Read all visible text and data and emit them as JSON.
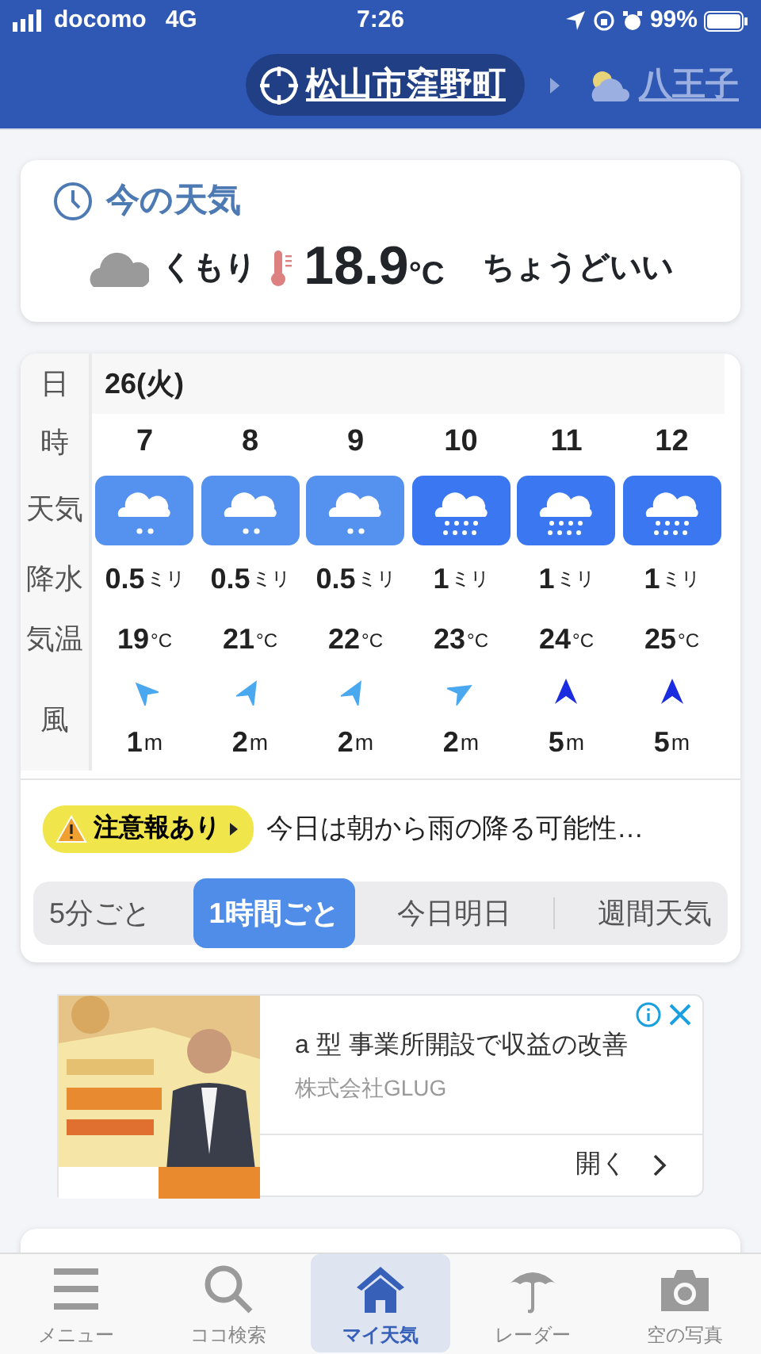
{
  "status_bar": {
    "carrier": "docomo",
    "network": "4G",
    "time": "7:26",
    "battery": "99%"
  },
  "locations": [
    {
      "name": "松山市窪野町",
      "selected": true
    },
    {
      "name": "八王子",
      "selected": false
    }
  ],
  "current": {
    "title": "今の天気",
    "condition": "くもり",
    "temperature": "18.9",
    "temperature_unit": "°C",
    "feeling": "ちょうどいい"
  },
  "hourly": {
    "labels": {
      "date": "日",
      "hour": "時",
      "weather": "天気",
      "precip": "降水",
      "temp": "気温",
      "wind": "風"
    },
    "date": "26(火)",
    "hours": [
      {
        "hour": "7",
        "kind": "light-rain",
        "precip": "0.5",
        "precip_unit": "ミリ",
        "temp": "19",
        "temp_unit": "°C",
        "wind": {
          "kind": "se",
          "strong": false,
          "speed": "1",
          "unit": "m"
        }
      },
      {
        "hour": "8",
        "kind": "light-rain",
        "precip": "0.5",
        "precip_unit": "ミリ",
        "temp": "21",
        "temp_unit": "°C",
        "wind": {
          "kind": "ssw",
          "strong": false,
          "speed": "2",
          "unit": "m"
        }
      },
      {
        "hour": "9",
        "kind": "light-rain",
        "precip": "0.5",
        "precip_unit": "ミリ",
        "temp": "22",
        "temp_unit": "°C",
        "wind": {
          "kind": "ssw",
          "strong": false,
          "speed": "2",
          "unit": "m"
        }
      },
      {
        "hour": "10",
        "kind": "rain",
        "precip": "1",
        "precip_unit": "ミリ",
        "temp": "23",
        "temp_unit": "°C",
        "wind": {
          "kind": "wsw",
          "strong": false,
          "speed": "2",
          "unit": "m"
        }
      },
      {
        "hour": "11",
        "kind": "rain",
        "precip": "1",
        "precip_unit": "ミリ",
        "temp": "24",
        "temp_unit": "°C",
        "wind": {
          "kind": "s",
          "strong": true,
          "speed": "5",
          "unit": "m"
        }
      },
      {
        "hour": "12",
        "kind": "rain",
        "precip": "1",
        "precip_unit": "ミリ",
        "temp": "25",
        "temp_unit": "°C",
        "wind": {
          "kind": "s",
          "strong": true,
          "speed": "5",
          "unit": "m"
        }
      }
    ]
  },
  "alert": {
    "badge": "注意報あり",
    "text": "今日は朝から雨の降る可能性…"
  },
  "views": [
    {
      "label": "5分ごと",
      "selected": false
    },
    {
      "label": "1時間ごと",
      "selected": true
    },
    {
      "label": "今日明日",
      "selected": false
    },
    {
      "label": "週間天気",
      "selected": false
    }
  ],
  "ad": {
    "kind": "picture",
    "headline": "a 型 事業所開設で収益の改善",
    "advertiser": "株式会社GLUG",
    "open": "開く"
  },
  "tabs": [
    {
      "label": "メニュー",
      "kind": "menu",
      "selected": false
    },
    {
      "label": "ココ検索",
      "kind": "search",
      "selected": false
    },
    {
      "label": "マイ天気",
      "kind": "home",
      "selected": true
    },
    {
      "label": "レーダー",
      "kind": "radar",
      "selected": false
    },
    {
      "label": "空の写真",
      "kind": "camera",
      "selected": false
    }
  ]
}
